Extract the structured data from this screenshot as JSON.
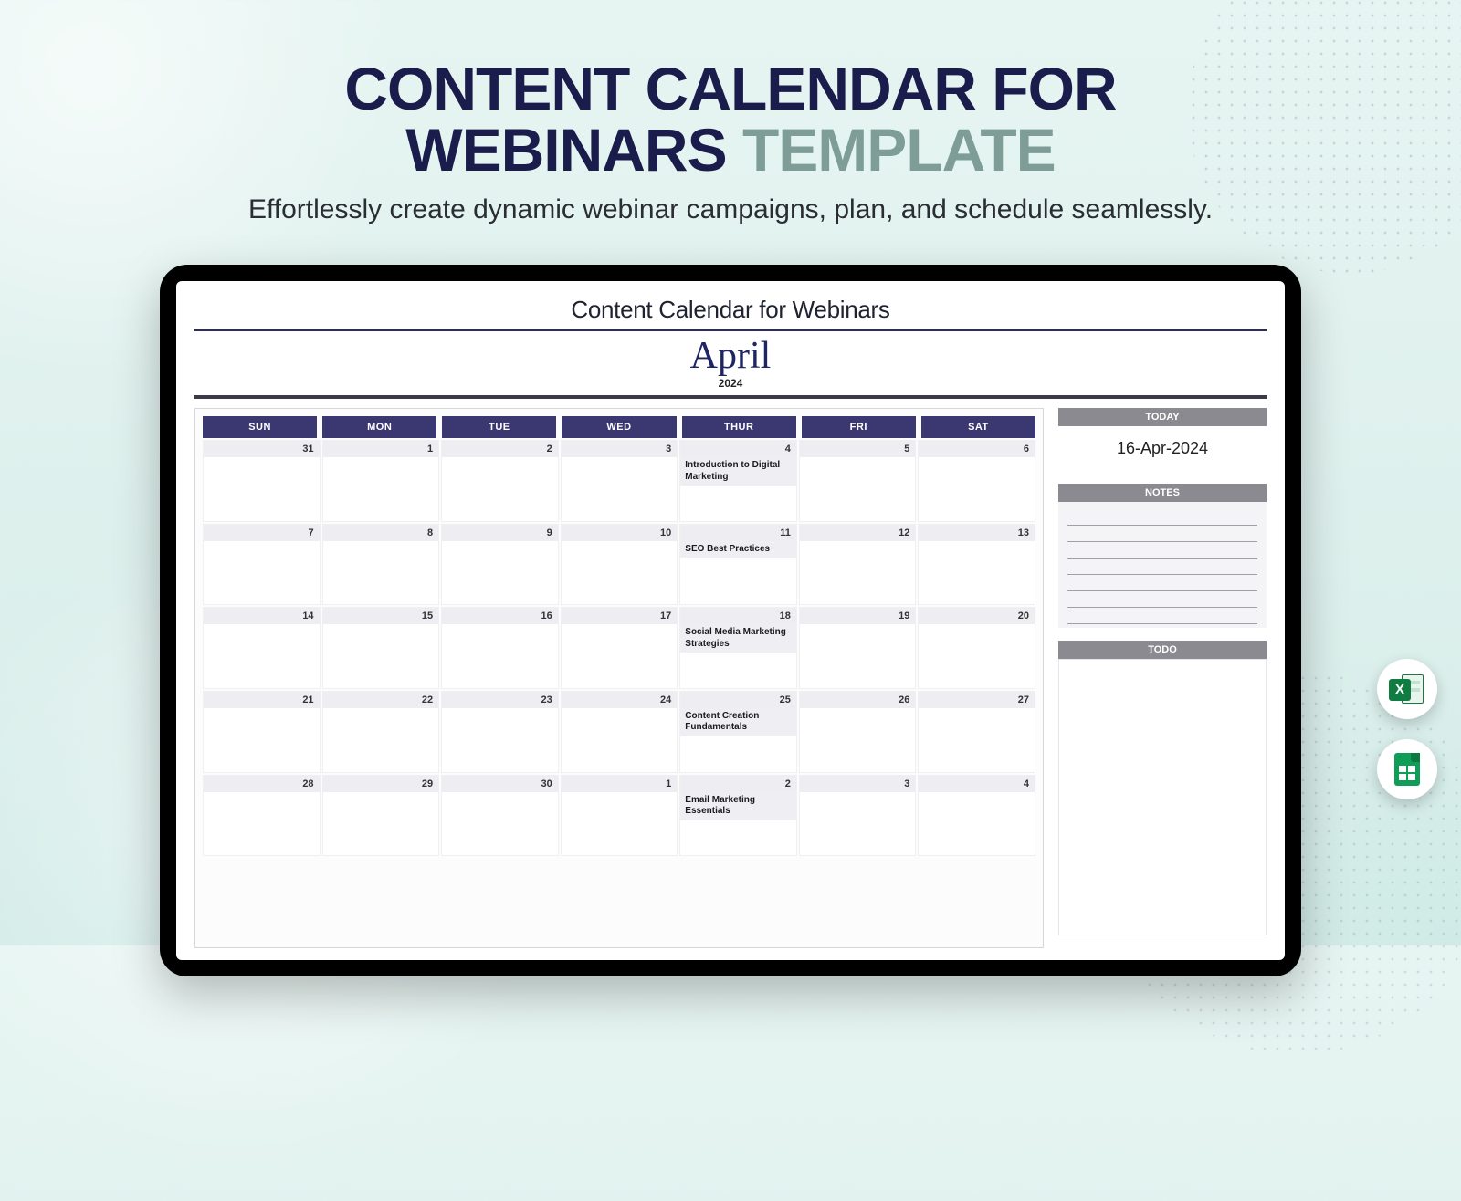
{
  "hero": {
    "title_line1": "CONTENT CALENDAR FOR",
    "title_line2a": "WEBINARS ",
    "title_line2b": "TEMPLATE",
    "subtitle": "Effortlessly create dynamic webinar campaigns, plan, and schedule seamlessly."
  },
  "document": {
    "title": "Content Calendar for Webinars",
    "month": "April",
    "year": "2024"
  },
  "calendar": {
    "day_headers": [
      "SUN",
      "MON",
      "TUE",
      "WED",
      "THUR",
      "FRI",
      "SAT"
    ],
    "weeks": [
      [
        {
          "num": "31"
        },
        {
          "num": "1"
        },
        {
          "num": "2"
        },
        {
          "num": "3"
        },
        {
          "num": "4",
          "event": "Introduction to Digital Marketing"
        },
        {
          "num": "5"
        },
        {
          "num": "6"
        }
      ],
      [
        {
          "num": "7"
        },
        {
          "num": "8"
        },
        {
          "num": "9"
        },
        {
          "num": "10"
        },
        {
          "num": "11",
          "event": "SEO Best Practices"
        },
        {
          "num": "12"
        },
        {
          "num": "13"
        }
      ],
      [
        {
          "num": "14"
        },
        {
          "num": "15"
        },
        {
          "num": "16"
        },
        {
          "num": "17"
        },
        {
          "num": "18",
          "event": "Social Media Marketing Strategies"
        },
        {
          "num": "19"
        },
        {
          "num": "20"
        }
      ],
      [
        {
          "num": "21"
        },
        {
          "num": "22"
        },
        {
          "num": "23"
        },
        {
          "num": "24"
        },
        {
          "num": "25",
          "event": "Content Creation Fundamentals"
        },
        {
          "num": "26"
        },
        {
          "num": "27"
        }
      ],
      [
        {
          "num": "28"
        },
        {
          "num": "29"
        },
        {
          "num": "30"
        },
        {
          "num": "1"
        },
        {
          "num": "2",
          "event": "Email Marketing Essentials"
        },
        {
          "num": "3"
        },
        {
          "num": "4"
        }
      ],
      []
    ]
  },
  "sidebar": {
    "today_label": "TODAY",
    "today_value": "16-Apr-2024",
    "notes_label": "NOTES",
    "todo_label": "TODO"
  },
  "icons": {
    "excel": "X",
    "sheets": "sheets"
  }
}
